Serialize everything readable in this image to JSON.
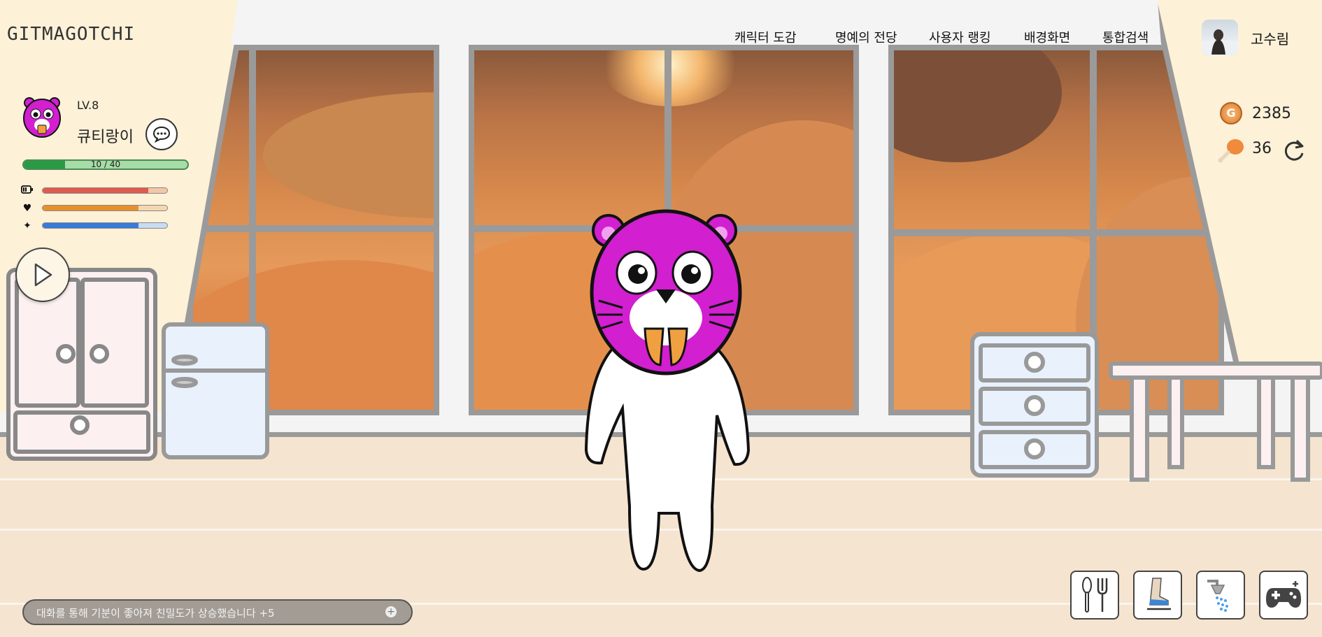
{
  "app": {
    "logo": "GITMAGOTCHI"
  },
  "nav": {
    "items": [
      {
        "label": "캐릭터 도감"
      },
      {
        "label": "명예의 전당"
      },
      {
        "label": "사용자 랭킹"
      },
      {
        "label": "배경화면"
      },
      {
        "label": "통합검색"
      }
    ]
  },
  "user": {
    "name": "고수림",
    "avatar_icon": "user-avatar-photo"
  },
  "character": {
    "level": "LV.8",
    "name": "큐티랑이",
    "xp_text": "10 / 40",
    "xp_fraction": 0.25,
    "stats": [
      {
        "icon": "battery-icon",
        "fraction": 0.85,
        "color": "#e05a4e"
      },
      {
        "icon": "heart-icon",
        "fraction": 0.77,
        "color": "#e8902e"
      },
      {
        "icon": "sparkle-icon",
        "fraction": 0.77,
        "color": "#3a7ad8"
      }
    ]
  },
  "currency": {
    "coin_symbol": "G",
    "coins": "2385",
    "food": "36"
  },
  "message": {
    "text": "대화를 통해 기분이 좋아져 친밀도가 상승했습니다 +5"
  },
  "actions": [
    {
      "name": "feed-button",
      "icon": "spoon-fork-icon"
    },
    {
      "name": "walk-button",
      "icon": "skate-icon"
    },
    {
      "name": "shower-button",
      "icon": "shower-icon"
    },
    {
      "name": "game-button",
      "icon": "gamepad-icon"
    }
  ],
  "background": {
    "theme": "desert"
  }
}
